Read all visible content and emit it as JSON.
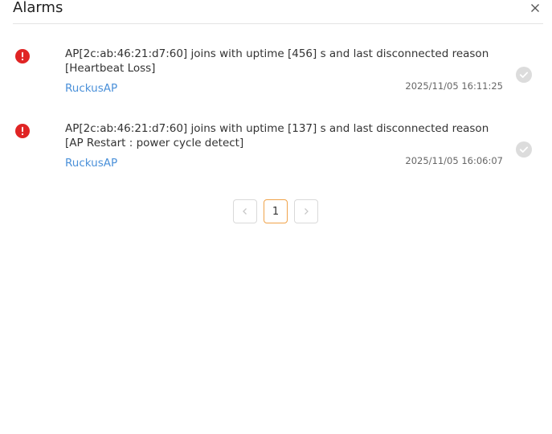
{
  "header": {
    "title": "Alarms"
  },
  "alarms": [
    {
      "message": "AP[2c:ab:46:21:d7:60] joins with uptime [456] s and last disconnected reason [Heartbeat Loss]",
      "source": "RuckusAP",
      "timestamp": "2025/11/05 16:11:25",
      "severity_icon": "alert-circle-icon",
      "ack_icon": "check-circle-icon"
    },
    {
      "message": "AP[2c:ab:46:21:d7:60] joins with uptime [137] s and last disconnected reason [AP Restart : power cycle detect]",
      "source": "RuckusAP",
      "timestamp": "2025/11/05 16:06:07",
      "severity_icon": "alert-circle-icon",
      "ack_icon": "check-circle-icon"
    }
  ],
  "pagination": {
    "current_page": "1",
    "prev_icon": "chevron-left-icon",
    "next_icon": "chevron-right-icon"
  },
  "colors": {
    "severity": "#e02424",
    "link": "#4a90d9",
    "active_page_border": "#f0a34a",
    "ack": "#cccccc"
  }
}
